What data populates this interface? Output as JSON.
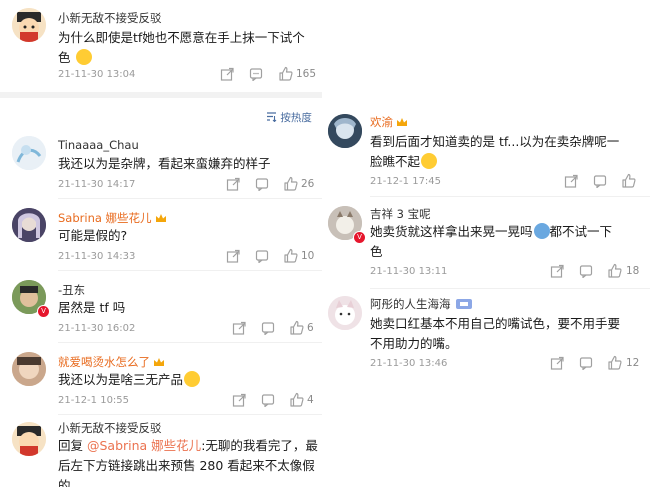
{
  "top_comment": {
    "user": "小新无敌不接受反驳",
    "text_line1": "为什么即使是tf她也不愿意在手上抹一下试个",
    "text_line2": "色",
    "date": "21-11-30 13:04",
    "likes": "165"
  },
  "sort_label": "按热度",
  "left_comments": [
    {
      "user": "Tinaaaa_Chau",
      "text": "我还以为是杂牌，看起来蛮嫌弃的样子",
      "date": "21-11-30 14:17",
      "likes": "26"
    },
    {
      "user": "Sabrina 娜些花儿",
      "text": "可能是假的?",
      "date": "21-11-30 14:33",
      "likes": "10"
    },
    {
      "user": "-丑东",
      "text": "居然是 tf 吗",
      "date": "21-11-30 16:02",
      "likes": "6"
    },
    {
      "user": "就爱喝烫水怎么了",
      "text": "我还以为是啥三无产品",
      "date": "21-12-1 10:55",
      "likes": "4"
    },
    {
      "user": "小新无敌不接受反驳",
      "reply_prefix": "回复 ",
      "mention": "@Sabrina 娜些花儿",
      "text_line1_rest": ":无聊的我看完了，最",
      "text_line2": "后左下方链接跳出来预售 280 看起来不太像假",
      "text_line3": "的"
    }
  ],
  "right_comments": [
    {
      "user": "欢渝",
      "text_line1": "看到后面才知道卖的是 tf...以为在卖杂牌呢一",
      "text_line2": "脸瞧不起",
      "date": "21-12-1 17:45",
      "likes": ""
    },
    {
      "user": "吉祥 3 宝呢",
      "text_line1": "她卖货就这样拿出来晃一晃吗",
      "text_line1b": "都不试一下",
      "text_line2": "色",
      "date": "21-11-30 13:11",
      "likes": "18"
    },
    {
      "user": "阿彤的人生海海",
      "text_line1": "她卖口红基本不用自己的嘴试色，要不用手要",
      "text_line2": "不用助力的嘴。",
      "date": "21-11-30 13:46",
      "likes": "12"
    }
  ],
  "colors": {
    "accent": "#e86b1f",
    "link": "#eb7350",
    "sort": "#4a6da0",
    "badge": "#e6162d"
  },
  "icons": [
    "share-icon",
    "comment-icon",
    "like-icon",
    "crown-icon",
    "sort-icon",
    "emoji-icon"
  ]
}
